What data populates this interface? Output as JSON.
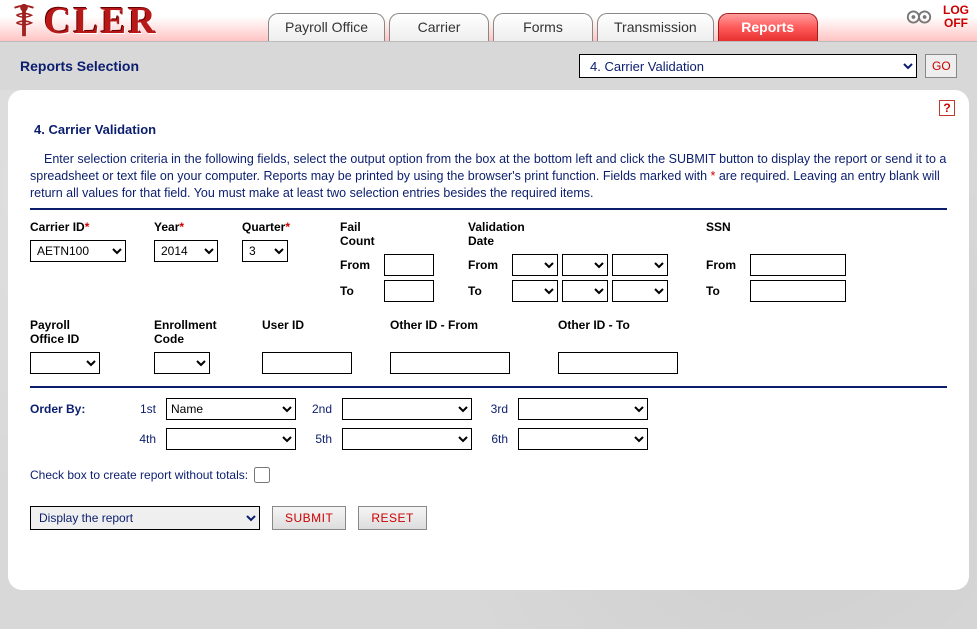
{
  "brand": {
    "text": "CLER"
  },
  "nav": {
    "tabs": [
      {
        "label": "Payroll Office"
      },
      {
        "label": "Carrier"
      },
      {
        "label": "Forms"
      },
      {
        "label": "Transmission"
      },
      {
        "label": "Reports"
      }
    ],
    "logoff_line1": "LOG",
    "logoff_line2": "OFF"
  },
  "subhead": {
    "title": "Reports Selection",
    "selected": "4. Carrier Validation",
    "go": "GO"
  },
  "panel": {
    "title": "4. Carrier Validation",
    "instructions_pre": "Enter selection criteria in the following fields, select the output option from the box at the bottom left and click the SUBMIT button to display the report or send it to a spreadsheet or text file on your computer.  Reports may be printed by using the browser's print function.  Fields marked with ",
    "star": "*",
    "instructions_post": " are required.  Leaving an entry blank will return all values for that field.  You must make at least two selection entries besides the required items.",
    "help": "?",
    "labels": {
      "carrier_id": "Carrier ID",
      "year": "Year",
      "quarter": "Quarter",
      "fail_count_l1": "Fail",
      "fail_count_l2": "Count",
      "validation_date_l1": "Validation",
      "validation_date_l2": "Date",
      "ssn": "SSN",
      "from": "From",
      "to": "To",
      "payroll_l1": "Payroll",
      "payroll_l2": "Office ID",
      "enroll_l1": "Enrollment",
      "enroll_l2": "Code",
      "user_id": "User ID",
      "other_from": "Other ID - From",
      "other_to": "Other ID - To",
      "order_by": "Order By:",
      "ord": [
        "1st",
        "2nd",
        "3rd",
        "4th",
        "5th",
        "6th"
      ],
      "checkbox": "Check box to create report without totals:",
      "submit": "SUBMIT",
      "reset": "RESET"
    },
    "values": {
      "carrier_id": "AETN100",
      "year": "2014",
      "quarter": "3",
      "order1": "Name",
      "output": "Display the report"
    }
  }
}
